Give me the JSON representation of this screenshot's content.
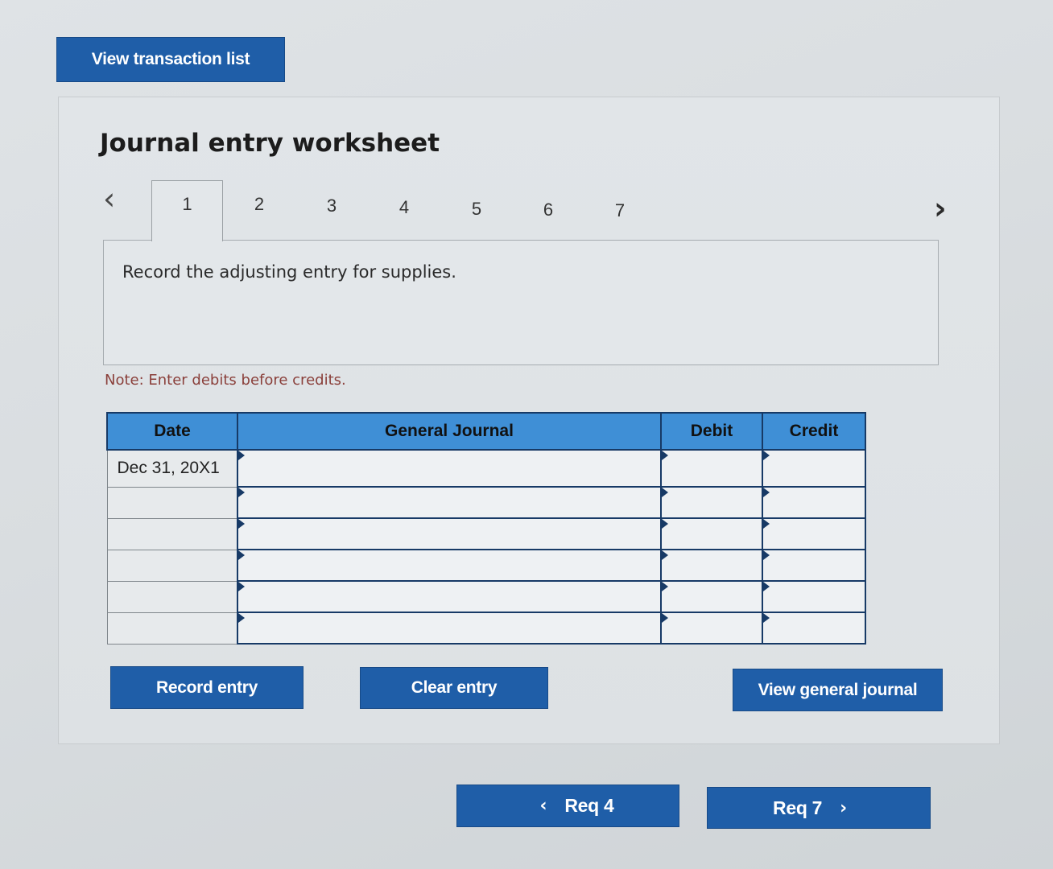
{
  "header": {
    "view_transaction_list_label": "View transaction list"
  },
  "worksheet": {
    "title": "Journal entry worksheet",
    "tabs": [
      "1",
      "2",
      "3",
      "4",
      "5",
      "6",
      "7"
    ],
    "active_tab": "1",
    "prev_icon": "chevron-left-icon",
    "next_icon": "chevron-right-icon",
    "instruction": "Record the adjusting entry for supplies.",
    "note": "Note: Enter debits before credits."
  },
  "journal_table": {
    "columns": [
      "Date",
      "General Journal",
      "Debit",
      "Credit"
    ],
    "rows": [
      {
        "date": "Dec 31, 20X1",
        "account": "",
        "debit": "",
        "credit": ""
      },
      {
        "date": "",
        "account": "",
        "debit": "",
        "credit": ""
      },
      {
        "date": "",
        "account": "",
        "debit": "",
        "credit": ""
      },
      {
        "date": "",
        "account": "",
        "debit": "",
        "credit": ""
      },
      {
        "date": "",
        "account": "",
        "debit": "",
        "credit": ""
      },
      {
        "date": "",
        "account": "",
        "debit": "",
        "credit": ""
      }
    ]
  },
  "actions": {
    "record_entry_label": "Record entry",
    "clear_entry_label": "Clear entry",
    "view_general_journal_label": "View general journal"
  },
  "navigation": {
    "prev_label": "Req 4",
    "next_label": "Req 7"
  },
  "colors": {
    "button_blue": "#1f5ea8",
    "header_blue": "#3f8fd6",
    "border_navy": "#173a66",
    "note_red": "#8a3f3a"
  }
}
